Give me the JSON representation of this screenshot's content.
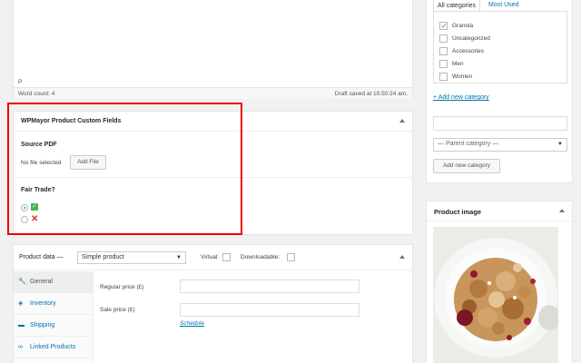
{
  "editor": {
    "path_tag": "P",
    "word_count": "Word count: 4",
    "draft_status": "Draft saved at 10:50:24 am."
  },
  "custom_fields": {
    "title": "WPMayor Product Custom Fields",
    "source_pdf_label": "Source PDF",
    "no_file_text": "No file selected",
    "add_file_label": "Add File",
    "fair_trade_label": "Fair Trade?",
    "fair_trade_selected": "yes"
  },
  "product_data": {
    "title": "Product data —",
    "type_select": "Simple product",
    "virtual_label": "Virtual:",
    "downloadable_label": "Downloadable:",
    "tabs": [
      {
        "label": "General",
        "icon": "wrench-icon"
      },
      {
        "label": "Inventory",
        "icon": "tag-icon"
      },
      {
        "label": "Shipping",
        "icon": "truck-icon"
      },
      {
        "label": "Linked Products",
        "icon": "link-icon"
      }
    ],
    "regular_price_label": "Regular price (£)",
    "sale_price_label": "Sale price (£)",
    "schedule_link": "Schedule"
  },
  "categories": {
    "tab_all": "All categories",
    "tab_most_used": "Most Used",
    "items": [
      {
        "name": "Granola",
        "checked": true
      },
      {
        "name": "Uncategorized",
        "checked": false
      },
      {
        "name": "Accessories",
        "checked": false
      },
      {
        "name": "Men",
        "checked": false
      },
      {
        "name": "Women",
        "checked": false
      }
    ],
    "add_new_link": "+ Add new category",
    "parent_select": "— Parent category —",
    "add_button": "Add new category"
  },
  "product_image": {
    "title": "Product image"
  },
  "colors": {
    "accent": "#0073aa",
    "highlight": "#e00000",
    "check_green": "#46b450",
    "x_red": "#dc3232"
  }
}
